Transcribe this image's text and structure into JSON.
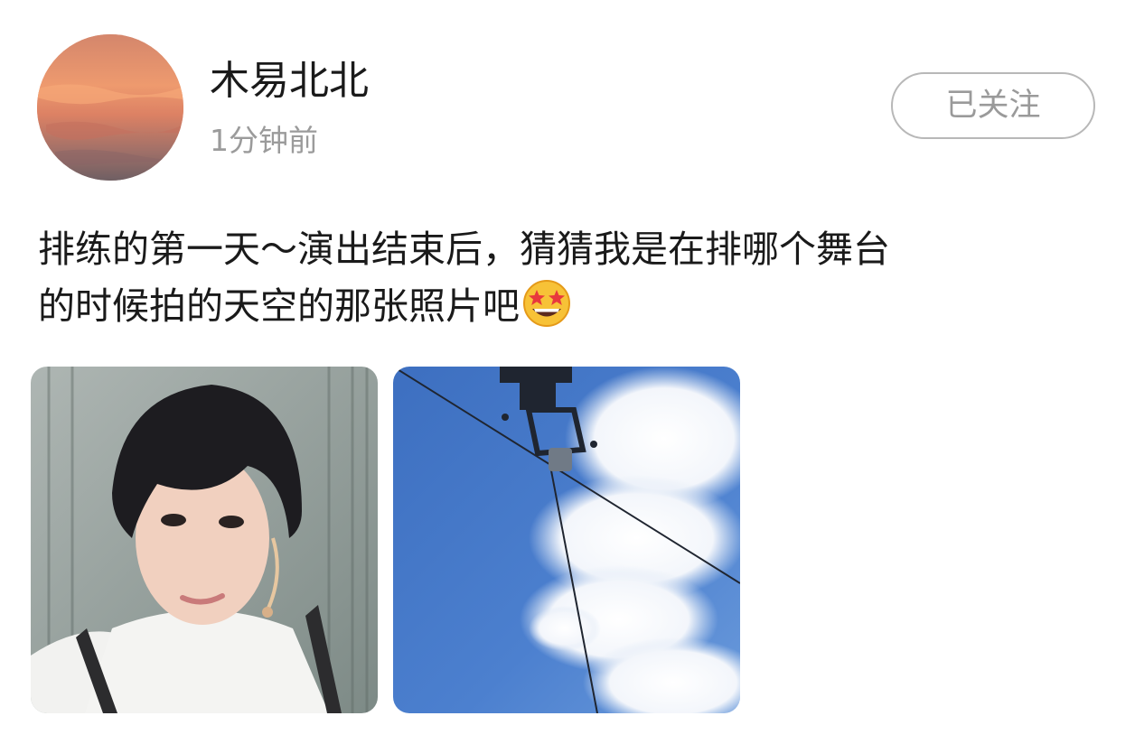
{
  "post": {
    "author": {
      "name": "木易北北",
      "avatar_icon": "sunset-sky-avatar"
    },
    "timestamp": "1分钟前",
    "follow_button_label": "已关注",
    "text_line_1": "排练的第一天～演出结束后，猜猜我是在排哪个舞台",
    "text_line_2": "的时候拍的天空的那张照片吧",
    "emoji_icon": "star-struck-emoji-icon",
    "images": [
      {
        "icon": "selfie-photo",
        "description_icon": "person-photo-icon"
      },
      {
        "icon": "sky-photo",
        "description_icon": "blue-sky-camera-crane-icon"
      }
    ]
  },
  "colors": {
    "text_primary": "#1a1a1a",
    "text_secondary": "#9b9b9b",
    "button_border": "#b8b8b8",
    "background": "#ffffff"
  }
}
